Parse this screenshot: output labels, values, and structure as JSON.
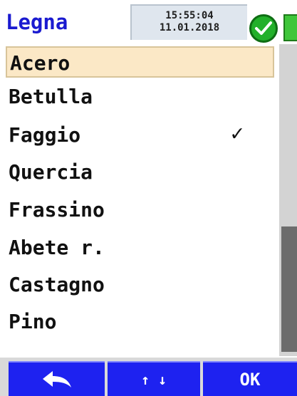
{
  "header": {
    "title": "Legna",
    "time": "15:55:04",
    "date": "11.01.2018",
    "status_icon": "check-circle-icon",
    "battery_icon": "battery-icon"
  },
  "list": {
    "items": [
      {
        "label": "Acero",
        "selected": true,
        "checked": false
      },
      {
        "label": "Betulla",
        "selected": false,
        "checked": false
      },
      {
        "label": "Faggio",
        "selected": false,
        "checked": true
      },
      {
        "label": "Quercia",
        "selected": false,
        "checked": false
      },
      {
        "label": "Frassino",
        "selected": false,
        "checked": false
      },
      {
        "label": "Abete r.",
        "selected": false,
        "checked": false
      },
      {
        "label": "Castagno",
        "selected": false,
        "checked": false
      },
      {
        "label": "Pino",
        "selected": false,
        "checked": false
      }
    ],
    "check_mark": "✓"
  },
  "footer": {
    "back_icon": "back-arrow-icon",
    "nav_label": "↑ ↓",
    "ok_label": "OK"
  },
  "colors": {
    "accent_blue": "#1e22f0",
    "title_blue": "#1a1ad0",
    "selection_bg": "#fbe8c6",
    "status_green": "#22b02a"
  }
}
